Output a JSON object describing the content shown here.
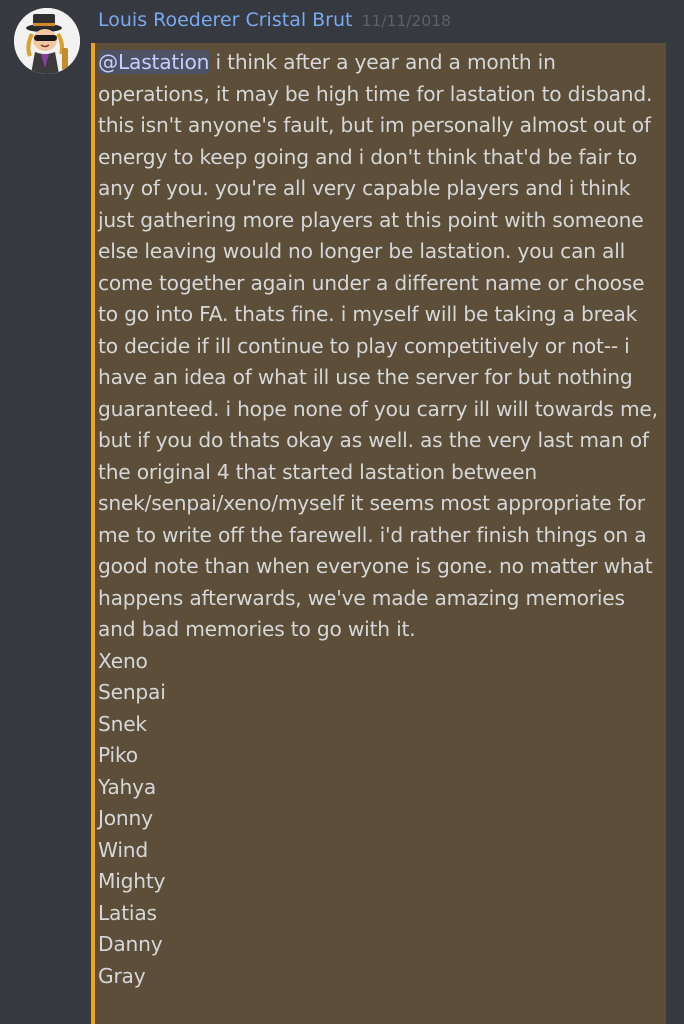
{
  "message": {
    "author": "Louis Roederer Cristal Brut",
    "timestamp": "11/11/2018",
    "mention": "@Lastation",
    "body": " i think after a year and a month in operations, it may be high time for lastation to disband. this isn't anyone's fault, but im personally almost out of energy to keep going and i don't think that'd be fair to any of you. you're all very capable players and i think just gathering more players at this point with someone else leaving would no longer be lastation. you can all come together again under a different name or choose to go into FA. thats fine. i myself will be taking a break to decide if ill continue to play competitively or not-- i have an idea of what ill use the server for but nothing guaranteed. i hope none of you carry ill will towards me, but if you do thats okay as well. as the very last man of the original 4 that started lastation between snek/senpai/xeno/myself it seems most appropriate for me to write off the farewell. i'd rather finish things on a good note than when everyone is gone. no matter what happens afterwards, we've made amazing memories and bad memories to go with it.",
    "names": [
      "Xeno",
      "Senpai",
      "Snek",
      "Piko",
      "Yahya",
      "Jonny",
      "Wind",
      "Mighty",
      "Latias",
      "Danny",
      "Gray"
    ]
  },
  "colors": {
    "background": "#36393f",
    "username": "#7aa9f0",
    "timestamp": "#5d6168",
    "highlight_bg": "#5c4e39",
    "highlight_bar": "#f2a31b",
    "text": "#d6d7d8",
    "mention_bg": "#4d5265"
  },
  "icons": {
    "avatar": "avatar-character-with-top-hat"
  }
}
